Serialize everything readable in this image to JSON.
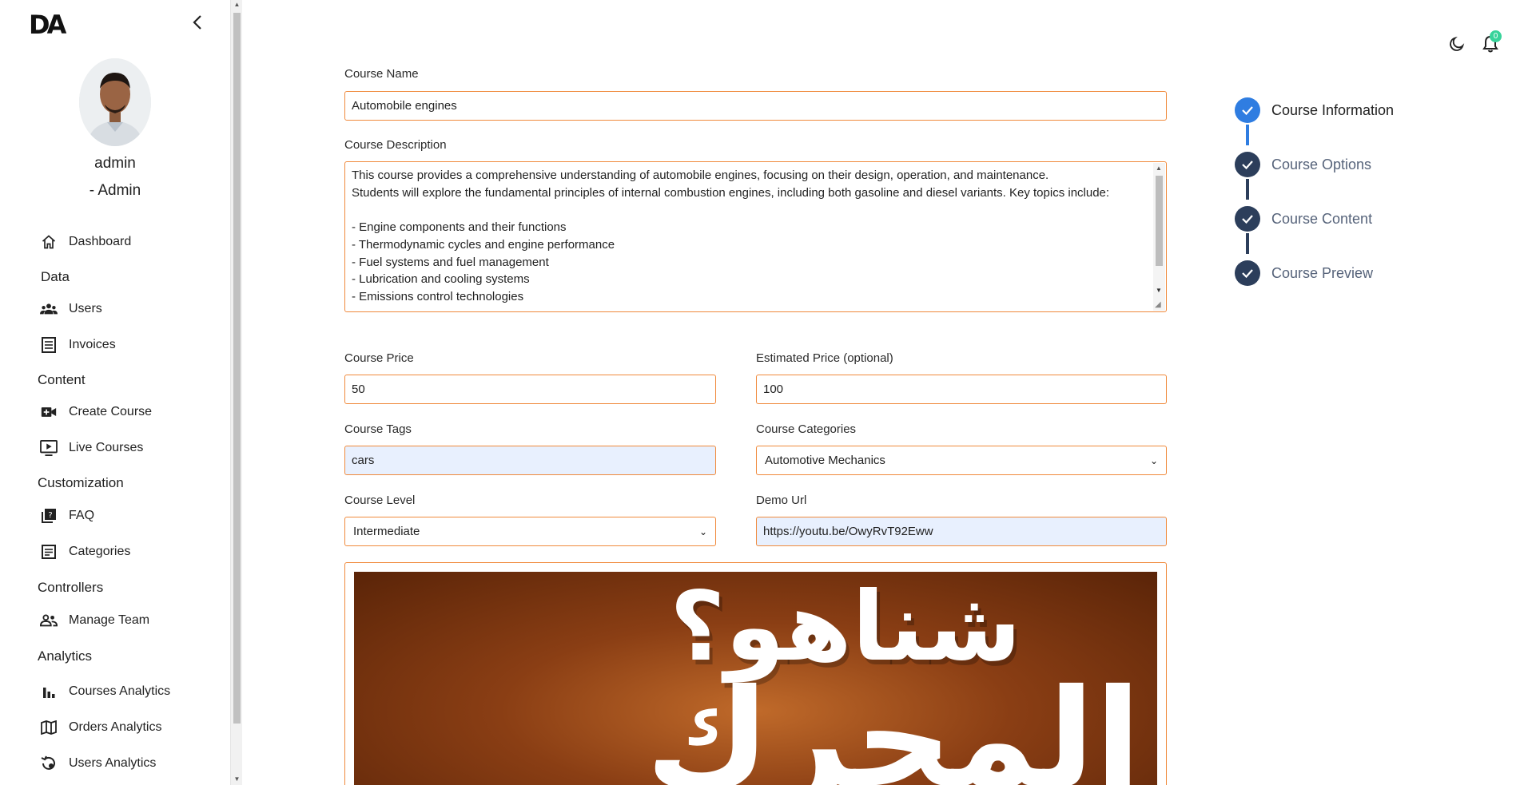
{
  "app": {
    "logo": "DA"
  },
  "user": {
    "name": "admin",
    "role": "- Admin"
  },
  "nav": {
    "dashboard": "Dashboard",
    "sections": {
      "data": "Data",
      "content": "Content",
      "customization": "Customization",
      "controllers": "Controllers",
      "analytics": "Analytics"
    },
    "users": "Users",
    "invoices": "Invoices",
    "create_course": "Create Course",
    "live_courses": "Live Courses",
    "faq": "FAQ",
    "categories": "Categories",
    "manage_team": "Manage Team",
    "courses_analytics": "Courses Analytics",
    "orders_analytics": "Orders Analytics",
    "users_analytics": "Users Analytics"
  },
  "header": {
    "notifications_count": "0"
  },
  "form": {
    "name_label": "Course Name",
    "name_value": "Automobile engines",
    "description_label": "Course Description",
    "description_value": "This course provides a comprehensive understanding of automobile engines, focusing on their design, operation, and maintenance.\nStudents will explore the fundamental principles of internal combustion engines, including both gasoline and diesel variants. Key topics include:\n\n- Engine components and their functions\n- Thermodynamic cycles and engine performance\n- Fuel systems and fuel management\n- Lubrication and cooling systems\n- Emissions control technologies",
    "price_label": "Course Price",
    "price_value": "50",
    "estimated_label": "Estimated Price (optional)",
    "estimated_value": "100",
    "tags_label": "Course Tags",
    "tags_value": "cars",
    "categories_label": "Course Categories",
    "categories_value": "Automotive Mechanics",
    "level_label": "Course Level",
    "level_value": "Intermediate",
    "demo_label": "Demo Url",
    "demo_value": "https://youtu.be/OwyRvT92Eww",
    "thumbnail_text_line1": "شناهو؟",
    "thumbnail_text_line2": "المحرك"
  },
  "steps": [
    {
      "label": "Course Information",
      "state": "active"
    },
    {
      "label": "Course Options",
      "state": "done"
    },
    {
      "label": "Course Content",
      "state": "done"
    },
    {
      "label": "Course Preview",
      "state": "done"
    }
  ],
  "colors": {
    "accent_border": "#f08a3c",
    "step_active": "#2f7de1",
    "step_done": "#2c3e5b",
    "badge": "#37d39a"
  }
}
